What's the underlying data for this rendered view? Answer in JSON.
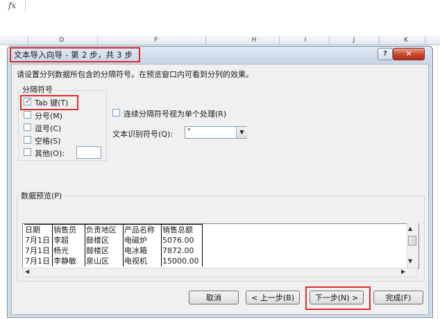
{
  "excel": {
    "formula_label": "fx",
    "columns": [
      "D",
      "E",
      "F",
      "G",
      "H",
      "I",
      "J",
      "K"
    ]
  },
  "dialog": {
    "title": "文本导入向导 - 第 2 步，共 3 步",
    "help_label": "?",
    "close_label": "✕",
    "instruction": "请设置分列数据所包含的分隔符号。在预览窗口内可看到分列的效果。",
    "delimiters": {
      "group_title": "分隔符号",
      "options": [
        {
          "label": "Tab 键(T)",
          "checked": true
        },
        {
          "label": "分号(M)",
          "checked": false
        },
        {
          "label": "逗号(C)",
          "checked": false
        },
        {
          "label": "空格(S)",
          "checked": false
        },
        {
          "label": "其他(O):",
          "checked": false
        }
      ],
      "other_value": ""
    },
    "consecutive": {
      "label": "连续分隔符号视为单个处理(R)",
      "checked": false
    },
    "text_qualifier": {
      "label": "文本识别符号(Q):",
      "value": "\""
    },
    "preview": {
      "title": "数据预览(P)",
      "rows": [
        [
          "日期",
          "销售员",
          "负责地区",
          "产品名称",
          "销售总额"
        ],
        [
          "7月1日",
          "李超",
          "鼓楼区",
          "电磁炉",
          "5076.00"
        ],
        [
          "7月1日",
          "杨光",
          "鼓楼区",
          "电冰箱",
          "7872.00"
        ],
        [
          "7月1日",
          "李静敏",
          "泉山区",
          "电视机",
          "15000.00"
        ]
      ]
    },
    "buttons": {
      "cancel": "取消",
      "back": "< 上一步(B)",
      "next": "下一步(N) >",
      "finish": "完成(F)"
    }
  },
  "colors": {
    "highlight": "#e0282b",
    "close_button": "#c9432d"
  }
}
